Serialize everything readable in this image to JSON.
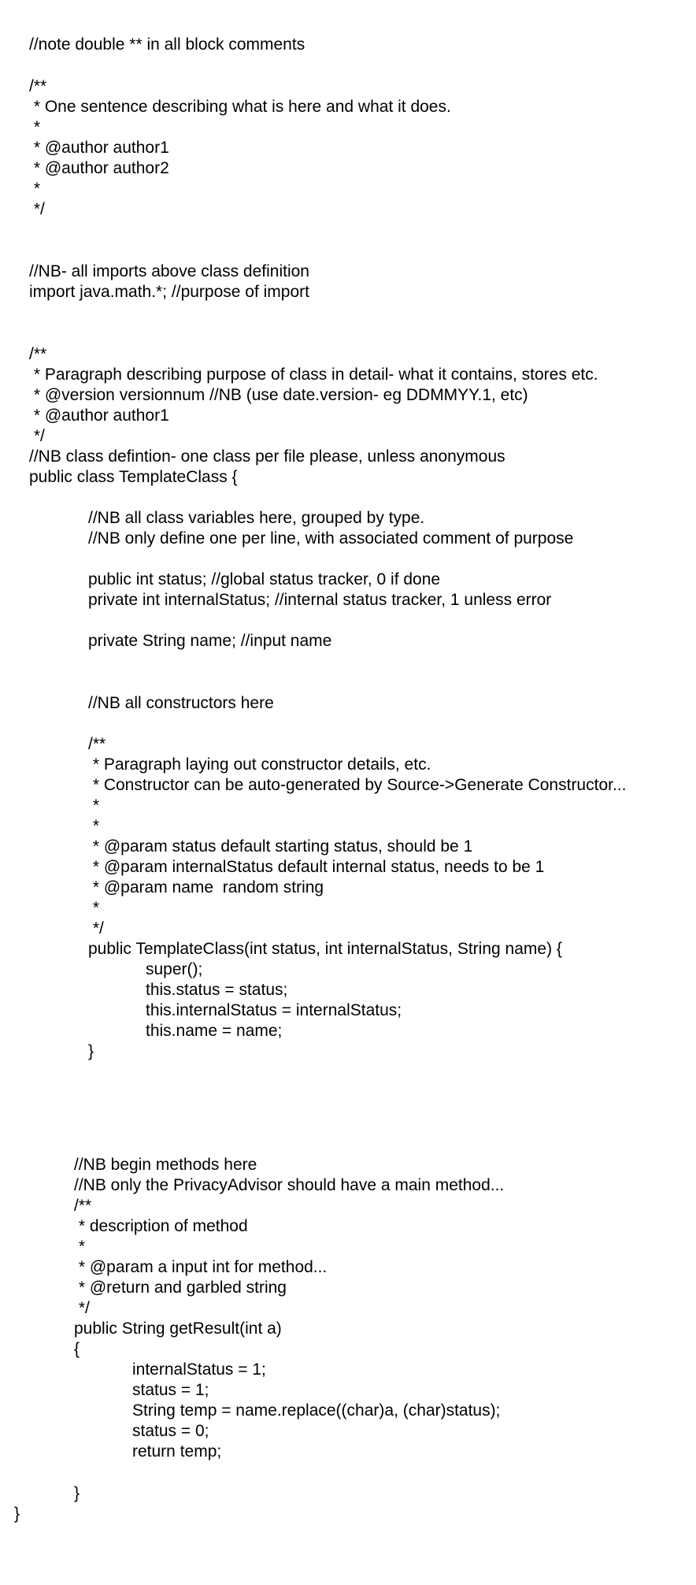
{
  "document": {
    "lines": [
      "//note double ** in all block comments",
      "/**",
      " * One sentence describing what is here and what it does.",
      " *",
      " * @author author1",
      " * @author author2",
      " *",
      " */",
      "//NB- all imports above class definition",
      "import java.math.*; //purpose of import",
      "/**",
      " * Paragraph describing purpose of class in detail- what it contains, stores etc.",
      " * @version versionnum //NB (use date.version- eg DDMMYY.1, etc)",
      " * @author author1",
      " */",
      "//NB class defintion- one class per file please, unless anonymous",
      "public class TemplateClass {",
      "//NB all class variables here, grouped by type.",
      "//NB only define one per line, with associated comment of purpose",
      "public int status; //global status tracker, 0 if done",
      "private int internalStatus; //internal status tracker, 1 unless error",
      "private String name; //input name",
      "//NB all constructors here",
      "/**",
      " * Paragraph laying out constructor details, etc.",
      " * Constructor can be auto-generated by Source->Generate Constructor...",
      " *",
      " *",
      " * @param status default starting status, should be 1",
      " * @param internalStatus default internal status, needs to be 1",
      " * @param name  random string",
      " *",
      " */",
      "public TemplateClass(int status, int internalStatus, String name) {",
      "super();",
      "this.status = status;",
      "this.internalStatus = internalStatus;",
      "this.name = name;",
      "}",
      "//NB begin methods here",
      "//NB only the PrivacyAdvisor should have a main method...",
      "/**",
      " * description of method",
      " *",
      " * @param a input int for method...",
      " * @return and garbled string",
      " */",
      "public String getResult(int a)",
      "{",
      "internalStatus = 1;",
      "status = 1;",
      "String temp = name.replace((char)a, (char)status);",
      "status = 0;",
      "return temp;",
      "}",
      "}"
    ]
  }
}
